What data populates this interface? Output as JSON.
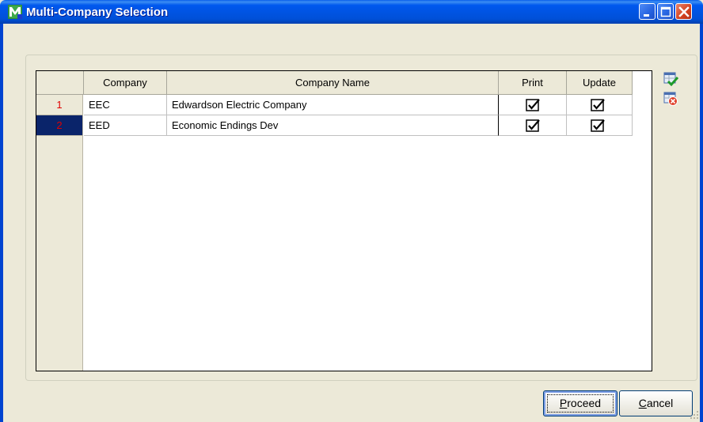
{
  "window": {
    "title": "Multi-Company Selection",
    "app_icon": "mas-m-icon"
  },
  "grid": {
    "columns": [
      "Company",
      "Company Name",
      "Print",
      "Update"
    ],
    "rows": [
      {
        "num": "1",
        "company": "EEC",
        "name": "Edwardson Electric Company",
        "print": true,
        "update": true
      },
      {
        "num": "2",
        "company": "EED",
        "name": "Economic Endings Dev",
        "print": true,
        "update": true
      }
    ],
    "selected_row": 2
  },
  "side_tools": [
    "select-all-icon",
    "clear-all-icon"
  ],
  "buttons": {
    "proceed": {
      "mnemonic": "P",
      "rest": "roceed"
    },
    "cancel": {
      "mnemonic": "C",
      "rest": "ancel"
    }
  },
  "colors": {
    "titlebar": "#0054E3",
    "face": "#ECE9D8",
    "selected_row_header": "#0A246A",
    "row_number_text": "#E00000"
  }
}
